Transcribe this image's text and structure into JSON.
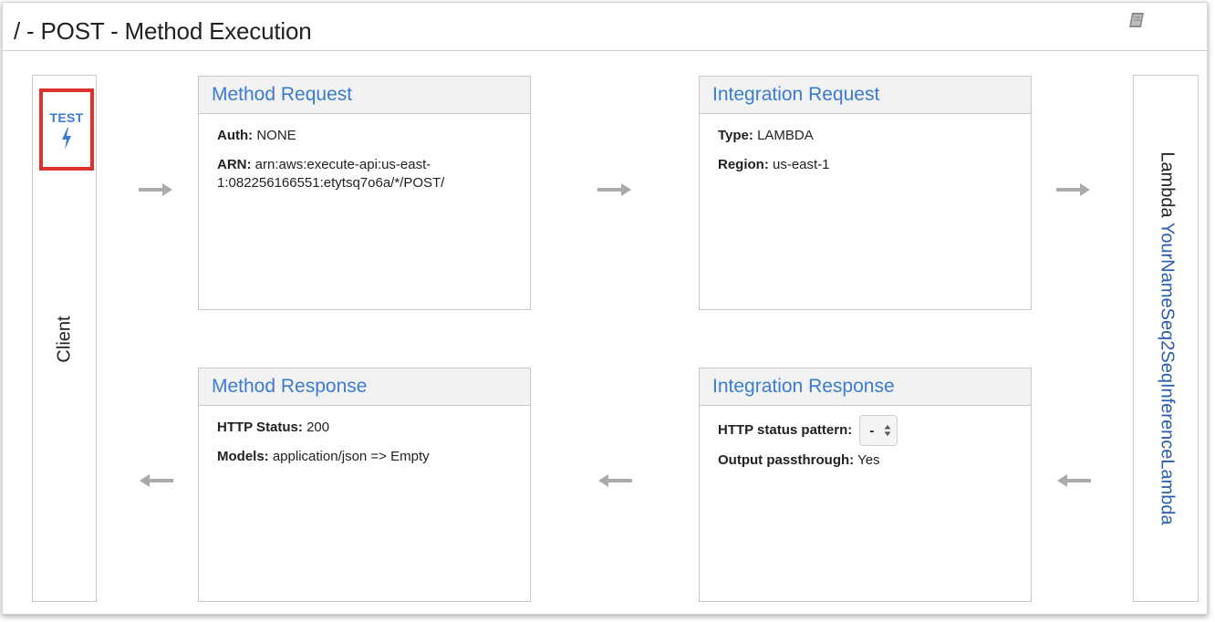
{
  "page": {
    "title": "/ - POST - Method Execution"
  },
  "client": {
    "test_label": "TEST",
    "label": "Client"
  },
  "lambda": {
    "prefix": "Lambda",
    "function_name": "YourNameSeq2SeqInferenceLambda"
  },
  "method_request": {
    "title": "Method Request",
    "auth_key": "Auth:",
    "auth_value": "NONE",
    "arn_key": "ARN:",
    "arn_value_line1": "arn:aws:execute-api:us-east-",
    "arn_value_line2": "1:082256166551:etytsq7o6a/*/POST/"
  },
  "integration_request": {
    "title": "Integration Request",
    "type_key": "Type:",
    "type_value": "LAMBDA",
    "region_key": "Region:",
    "region_value": "us-east-1"
  },
  "method_response": {
    "title": "Method Response",
    "status_key": "HTTP Status:",
    "status_value": "200",
    "models_key": "Models:",
    "models_value": "application/json => Empty"
  },
  "integration_response": {
    "title": "Integration Response",
    "pattern_key": "HTTP status pattern:",
    "pattern_value": "-",
    "passthrough_key": "Output passthrough:",
    "passthrough_value": "Yes"
  },
  "icons": {
    "book": "book-icon",
    "bolt": "lightning-bolt-icon",
    "arrow_right": "arrow-right-icon",
    "arrow_left": "arrow-left-icon",
    "select_caret": "select-caret-icon"
  },
  "colors": {
    "link_blue": "#3a7bd5",
    "highlight_red": "#e0322d",
    "arrow_gray": "#aaaaaa",
    "panel_header": "#f2f2f2"
  }
}
